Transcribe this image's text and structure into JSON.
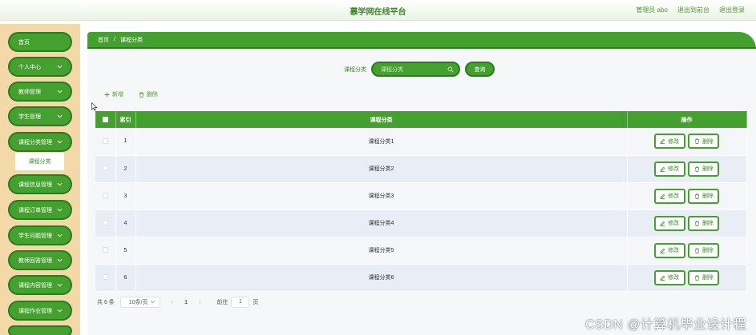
{
  "header": {
    "title": "慕学网在线平台",
    "user_label": "管理员 abo",
    "front_link": "退出到前台",
    "logout_link": "退出登录"
  },
  "sidebar": {
    "items": [
      {
        "label": "首页"
      },
      {
        "label": "个人中心"
      },
      {
        "label": "教师管理"
      },
      {
        "label": "学生管理"
      },
      {
        "label": "课程分类管理"
      },
      {
        "label": "课程信息管理"
      },
      {
        "label": "课程订单管理"
      },
      {
        "label": "学生问题管理"
      },
      {
        "label": "教师回答管理"
      },
      {
        "label": "课程内容管理"
      },
      {
        "label": "课程作业管理"
      }
    ],
    "submenu_label": "课程分类"
  },
  "breadcrumb": {
    "home": "首页",
    "separator": "/",
    "current": "课程分类"
  },
  "search": {
    "label": "课程分类",
    "placeholder": "课程分类",
    "button_label": "查询"
  },
  "toolbar": {
    "add_label": "新增",
    "delete_label": "删除"
  },
  "table": {
    "headers": {
      "index": "索引",
      "category": "课程分类",
      "actions": "操作"
    },
    "rows": [
      {
        "index": "1",
        "category": "课程分类1"
      },
      {
        "index": "2",
        "category": "课程分类2"
      },
      {
        "index": "3",
        "category": "课程分类3"
      },
      {
        "index": "4",
        "category": "课程分类4"
      },
      {
        "index": "5",
        "category": "课程分类5"
      },
      {
        "index": "6",
        "category": "课程分类6"
      }
    ],
    "edit_label": "修改",
    "delete_label": "删除"
  },
  "pagination": {
    "total": "共 6 条",
    "page_size": "10条/页",
    "current_page": "1",
    "goto_label": "前往",
    "goto_value": "1",
    "page_suffix": "页"
  },
  "watermark": "CSDN @计算机毕业设计程",
  "colors": {
    "primary": "#45a12f",
    "primary_dark": "#2e7a1f",
    "sidebar_bg": "#f3d8a8",
    "text_green": "#3a8a2a"
  }
}
